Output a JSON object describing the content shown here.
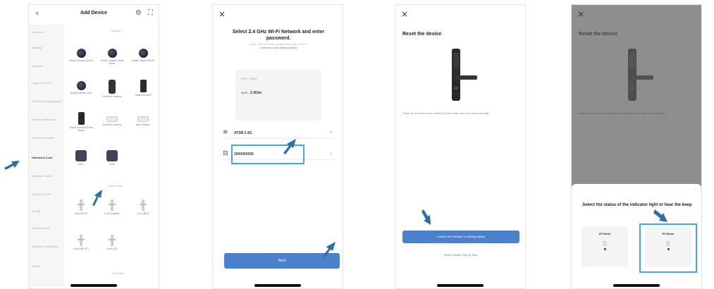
{
  "screen1": {
    "back": "‹",
    "title": "Add Device",
    "categories": [
      "Electrical",
      "Lighting",
      "Sensors",
      "Large Home Ap...",
      "Small Home Appliances",
      "Kitchen Appliances",
      "Exercise & Health",
      "Camera & Lock",
      "Gateway Control",
      "Outdoor Travel",
      "Energy",
      "Entertainment",
      "Industry & Agriculture",
      "Others"
    ],
    "active_category_index": 7,
    "section_camera": "Camera",
    "section_lock": "Smart Lock",
    "items": [
      {
        "label": "Smart Camera (Wi-Fi)",
        "icon": "camera-icon"
      },
      {
        "label": "Smart Camera (Dual Band)",
        "icon": "camera-icon"
      },
      {
        "label": "Smart Camera (BLE)",
        "icon": "camera-icon"
      },
      {
        "label": "Smart Camera (4G)",
        "icon": "camera-icon"
      },
      {
        "label": "Doorbell Camera",
        "icon": "doorbell-icon"
      },
      {
        "label": "Smart Doorbell",
        "icon": "doorbell-icon"
      },
      {
        "label": "Smart Doorbell (Dual Band)",
        "icon": "doorbell-icon"
      },
      {
        "label": "Doorbell Camera",
        "icon": "ptz-camera-icon"
      },
      {
        "label": "Base Station",
        "icon": "base-station-icon"
      },
      {
        "label": "NVR",
        "icon": "nvr-icon"
      },
      {
        "label": "DVR",
        "icon": "dvr-icon"
      },
      {
        "label": "Lock (Wi-Fi)",
        "icon": "lock-icon"
      },
      {
        "label": "Lock (Zigbee)",
        "icon": "lock-icon"
      },
      {
        "label": "Lock (BLE)",
        "icon": "lock-icon"
      },
      {
        "label": "Lock (NB-IoT)",
        "icon": "lock-icon"
      },
      {
        "label": "Lock (4G)",
        "icon": "lock-icon"
      }
    ],
    "footer_link": "Add more"
  },
  "screen2": {
    "close": "×",
    "title": "Select 2.4 GHz Wi-Fi Network and enter password.",
    "subtitle": "If your Wi-Fi is 5GHz, please set it to be 2.4GHz.",
    "subtitle_link": "Common router setting method",
    "card_row1": "Wi-Fi - 5Ghz",
    "card_row2_prefix": "Wi-Fi -",
    "card_row2_value": "2.4Ghz",
    "wifi_name": "ATSB 2.4G",
    "password": "2000000000",
    "next_button": "Next"
  },
  "screen3": {
    "close": "×",
    "title": "Reset the device",
    "description": "Power on the device and confirm that the smart door lock works normally.",
    "primary_button": "Confirm the indicator is blinking rapidly",
    "secondary_link": "Reset Device Step by Step"
  },
  "screen4": {
    "close": "×",
    "title": "Reset the device",
    "description": "Power on the device and confirm that the smart door lock works normally.",
    "sheet_close": "×",
    "sheet_title": "Select the status of the indicator light or hear the beep",
    "option_ap": "AP Mode",
    "option_ez": "EZ Mode"
  },
  "colors": {
    "accent_blue": "#4a80cc",
    "highlight_box": "#3fa9e0",
    "arrow": "#2c6fa8"
  }
}
